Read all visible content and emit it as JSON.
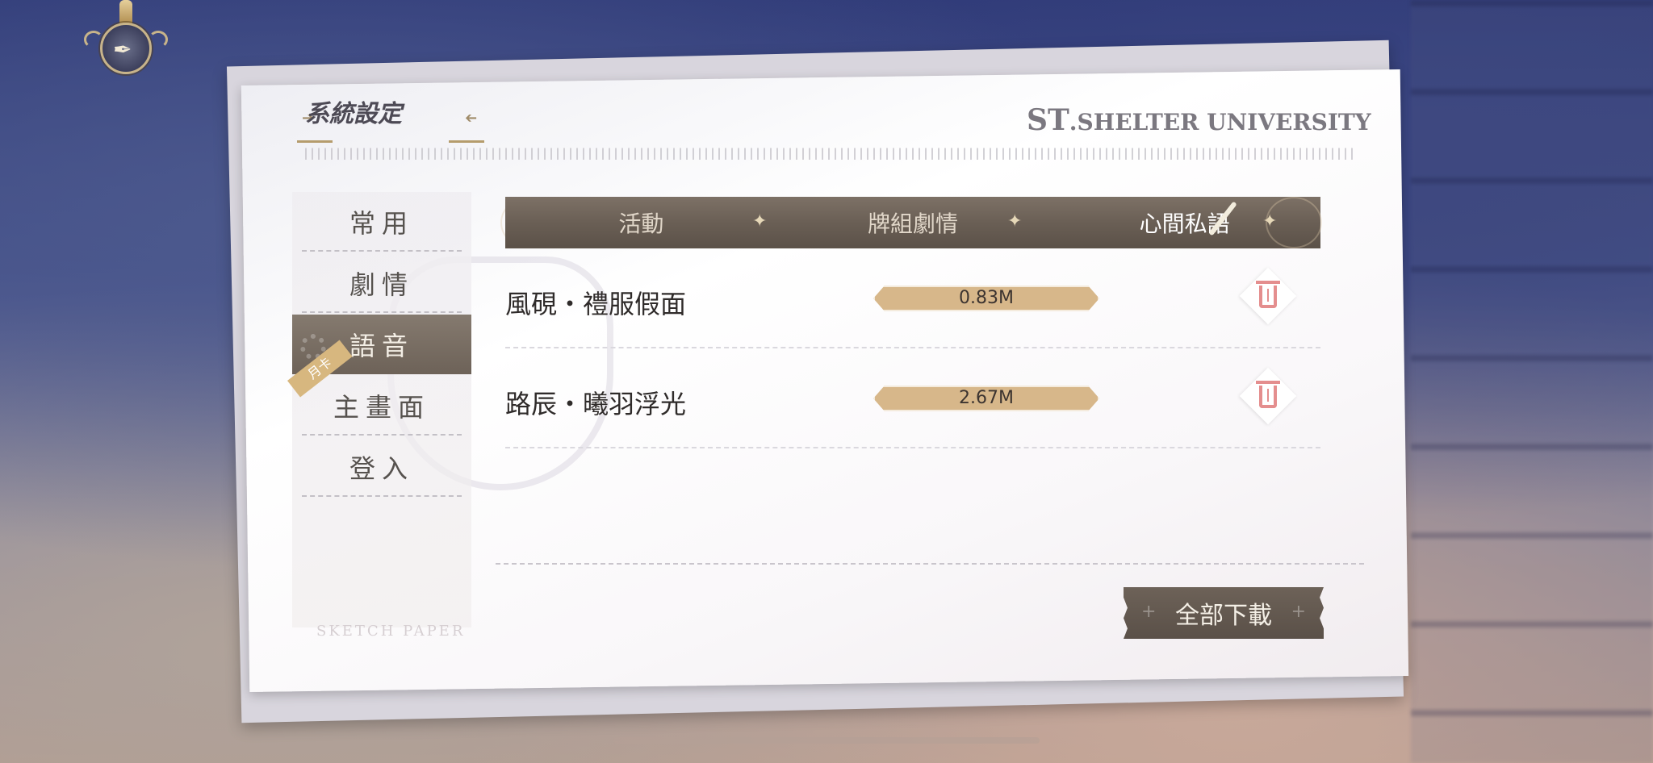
{
  "header": {
    "title": "系統設定",
    "brand_st": "ST",
    "brand_rest": ".SHELTER UNIVERSITY"
  },
  "sidebar": {
    "items": [
      {
        "label": "常用"
      },
      {
        "label": "劇情"
      },
      {
        "label": "語音",
        "active": true
      },
      {
        "label": "主畫面"
      },
      {
        "label": "登入"
      }
    ],
    "badge": "月卡",
    "footer": "SKETCH PAPER"
  },
  "tabs": [
    {
      "label": "活動"
    },
    {
      "label": "牌組劇情"
    },
    {
      "label": "心間私語",
      "active": true
    }
  ],
  "rows": [
    {
      "name": "風硯・禮服假面",
      "size": "0.83M"
    },
    {
      "name": "路辰・曦羽浮光",
      "size": "2.67M"
    }
  ],
  "actions": {
    "download_all": "全部下載"
  },
  "icons": [
    "back-icon",
    "gear-icon",
    "quill-icon",
    "trash-icon"
  ],
  "colors": {
    "tab_bar": "#6a5f55",
    "size_pill": "#d7b78a",
    "trash": "#e48e8e",
    "accent_gold": "#b59c6c"
  }
}
